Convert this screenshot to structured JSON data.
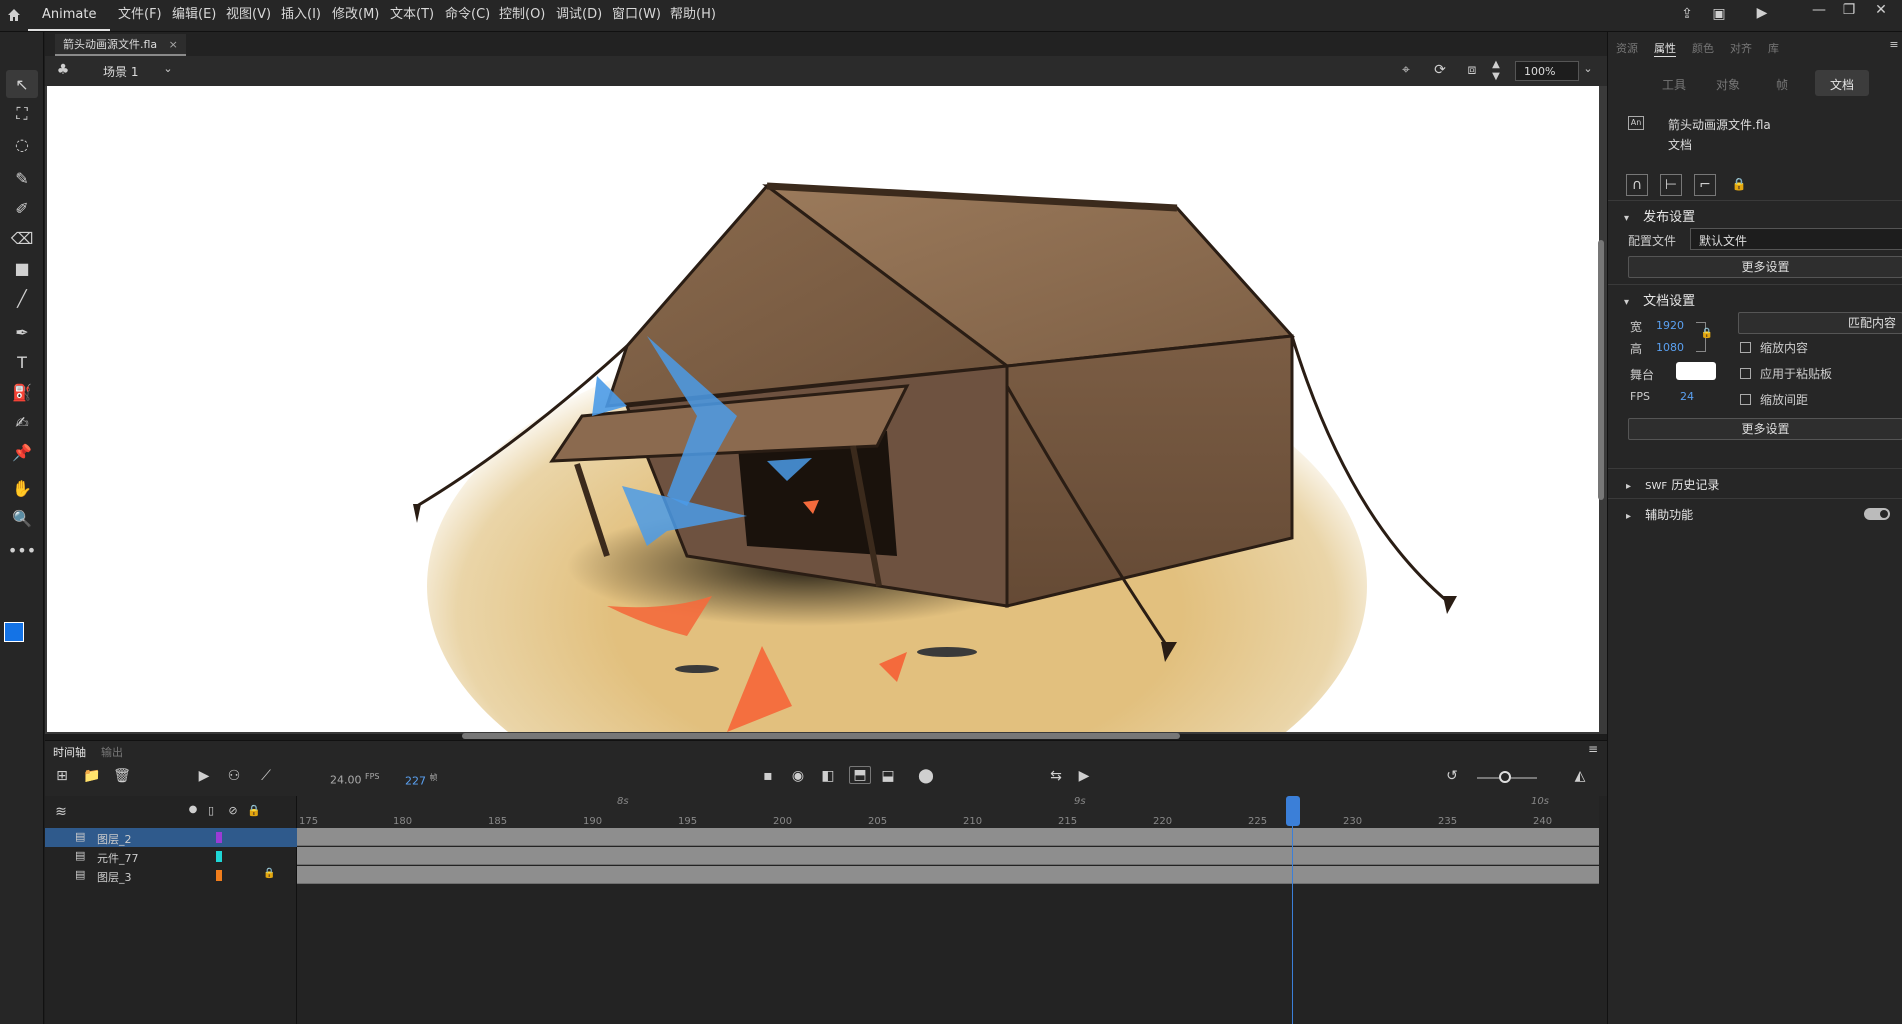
{
  "app": {
    "name": "Animate"
  },
  "menu": [
    "文件(F)",
    "编辑(E)",
    "视图(V)",
    "插入(I)",
    "修改(M)",
    "文本(T)",
    "命令(C)",
    "控制(O)",
    "调试(D)",
    "窗口(W)",
    "帮助(H)"
  ],
  "document": {
    "tab_name": "箭头动画源文件.fla"
  },
  "scene": {
    "name": "场景 1",
    "zoom": "100%"
  },
  "timeline": {
    "tabs": [
      "时间轴",
      "输出"
    ],
    "fps": "24.00",
    "fps_unit": "FPS",
    "frame": "227",
    "frame_unit": "帧",
    "second_markers": [
      "8s",
      "9s",
      "10s"
    ],
    "ticks": [
      "175",
      "180",
      "185",
      "190",
      "195",
      "200",
      "205",
      "210",
      "215",
      "220",
      "225",
      "230",
      "235",
      "240"
    ],
    "layers": [
      {
        "name": "图层_2",
        "color": "#9b3bd6",
        "selected": true,
        "locked": false
      },
      {
        "name": "元件_77",
        "color": "#1fd6d6",
        "selected": false,
        "locked": false
      },
      {
        "name": "图层_3",
        "color": "#f07d1c",
        "selected": false,
        "locked": true
      }
    ]
  },
  "right_panel": {
    "top_tabs": [
      "资源",
      "属性",
      "颜色",
      "对齐",
      "库"
    ],
    "subtabs": [
      "工具",
      "对象",
      "帧",
      "文档"
    ],
    "doc_filename": "箭头动画源文件.fla",
    "doc_type": "文档",
    "publish": {
      "title": "发布设置",
      "profile_label": "配置文件",
      "profile_value": "默认文件",
      "more": "更多设置"
    },
    "doc_settings": {
      "title": "文档设置",
      "width_label": "宽",
      "width_value": "1920",
      "height_label": "高",
      "height_value": "1080",
      "match_button": "匹配内容",
      "scale_content": "缩放内容",
      "stage_label": "舞台",
      "apply_pasteboard": "应用于粘贴板",
      "fps_label": "FPS",
      "fps_value": "24",
      "scale_spacing": "缩放间距",
      "more": "更多设置"
    },
    "swf_history": {
      "prefix": "SWF",
      "title": "历史记录"
    },
    "accessibility": "辅助功能"
  },
  "colors": {
    "accent": "#3b7fd8",
    "stroke_color": "#1473e6",
    "stage_color": "#ffffff",
    "arrow_blue": "#4b9be8",
    "arrow_orange": "#f46a3c"
  }
}
